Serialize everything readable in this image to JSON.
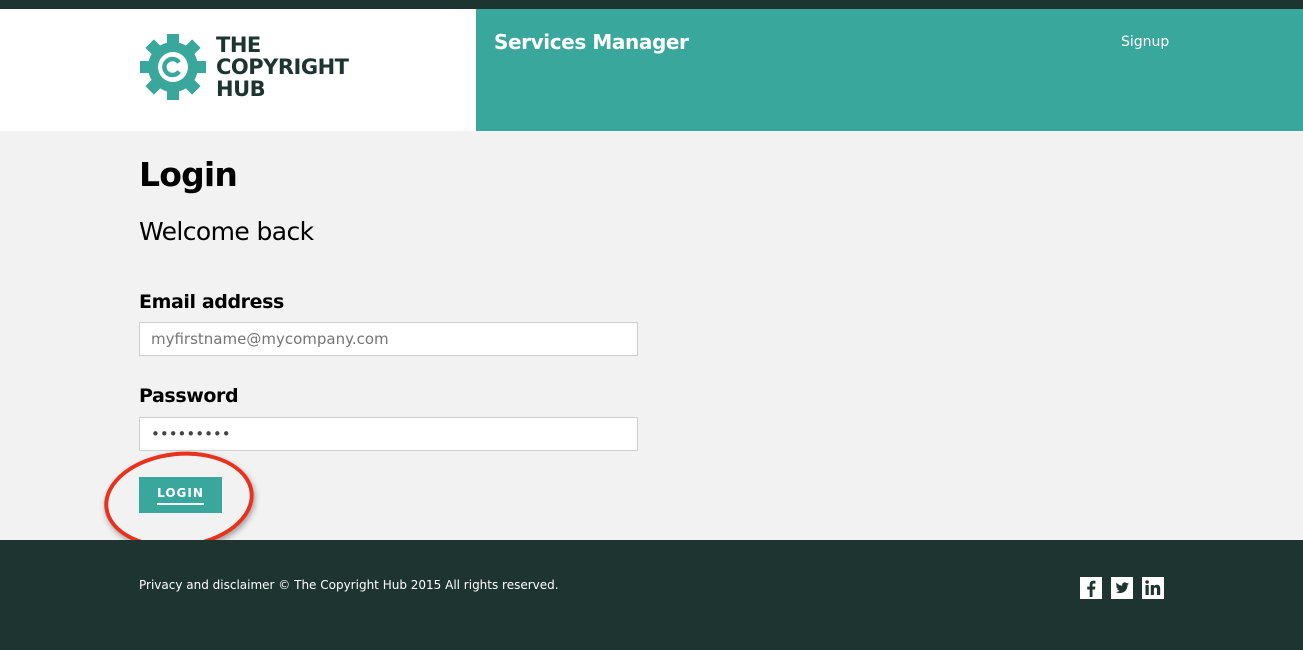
{
  "header": {
    "logo_lines": [
      "THE",
      "COPYRIGHT",
      "HUB"
    ],
    "app_title": "Services Manager",
    "signup_label": "Signup"
  },
  "main": {
    "title": "Login",
    "subtitle": "Welcome back",
    "email": {
      "label": "Email address",
      "placeholder": "myfirstname@mycompany.com",
      "value": ""
    },
    "password": {
      "label": "Password",
      "value": "•••••••••"
    },
    "login_label": "LOGIN"
  },
  "footer": {
    "text": "Privacy and disclaimer © The Copyright Hub 2015 All rights reserved.",
    "social_icons": [
      "facebook-icon",
      "twitter-icon",
      "linkedin-icon"
    ]
  },
  "colors": {
    "teal": "#39a79c",
    "dark": "#1d3431",
    "highlight": "#e8321e"
  }
}
